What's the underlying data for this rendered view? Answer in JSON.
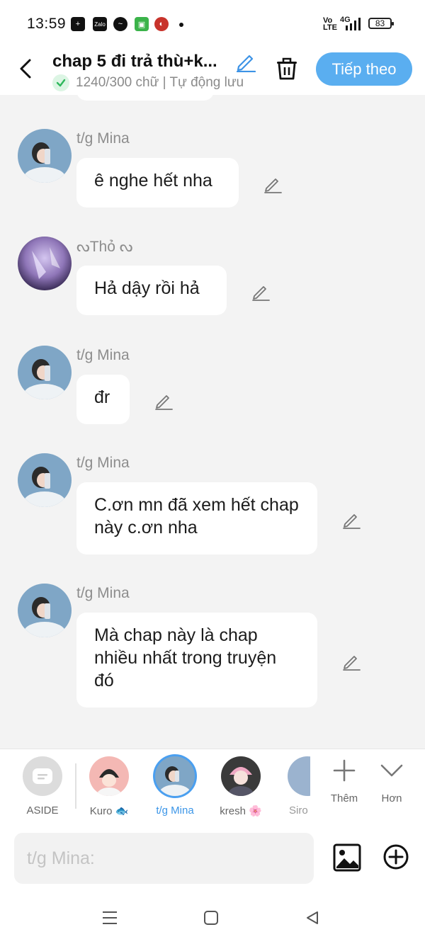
{
  "status_bar": {
    "time": "13:59",
    "signal_text_top": "Vo",
    "signal_text_bottom": "LTE",
    "network": "4G",
    "battery": "83"
  },
  "header": {
    "title": "chap 5 đi trả thù+k...",
    "subtitle": "1240/300 chữ | Tự động lưu",
    "next_label": "Tiếp theo"
  },
  "messages": [
    {
      "name": "t/g Mina",
      "text": "ê nghe hết nha"
    },
    {
      "name": "ᔓThỏ ᔓ",
      "text": "Hả dậy rồi hả"
    },
    {
      "name": "t/g Mina",
      "text": "đr"
    },
    {
      "name": "t/g Mina",
      "text": "C.ơn mn đã xem hết chap này c.ơn nha"
    },
    {
      "name": "t/g Mina",
      "text": "Mà chap này là chap nhiều nhất trong truyện đó"
    }
  ],
  "characters": {
    "aside": "ASIDE",
    "kuro": "Kuro 🐟",
    "mina": "t/g Mina",
    "kresh": "kresh 🌸",
    "siro": "Siro",
    "more_label": "Thêm",
    "less_label": "Hơn"
  },
  "composer": {
    "placeholder": "t/g Mina:"
  },
  "colors": {
    "accent": "#5aaef0",
    "background": "#f3f3f3"
  }
}
